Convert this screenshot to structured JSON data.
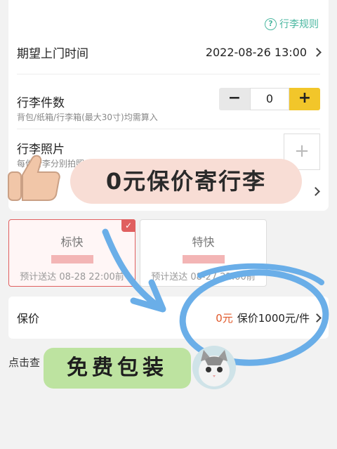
{
  "rules_link": "行李规则",
  "pickup_time": {
    "label": "期望上门时间",
    "value": "2022-08-26 13:00"
  },
  "luggage_count": {
    "label": "行李件数",
    "hint": "背包/纸箱/行李箱(最大30寸)均需算入",
    "minus": "−",
    "value": "0",
    "plus": "+"
  },
  "luggage_photo": {
    "label": "行李照片",
    "hint": "每件行李分别拍照上传",
    "add": "+"
  },
  "services": [
    {
      "name": "标快",
      "eta": "预计送达 08-28 22:00前",
      "selected": true
    },
    {
      "name": "特快",
      "eta": "预计送达 08-27 22:00前",
      "selected": false
    }
  ],
  "insurance": {
    "label": "保价",
    "amount": "0元",
    "desc": "保价1000元/件"
  },
  "agreement": "点击查",
  "stickers": {
    "zero_yuan": "0元保价寄行李",
    "free_packing": "免费包装"
  },
  "colors": {
    "accent_yellow": "#f2c62a",
    "teal": "#4ab7a0",
    "red": "#e06060",
    "doodle_blue": "#6aaee8"
  }
}
